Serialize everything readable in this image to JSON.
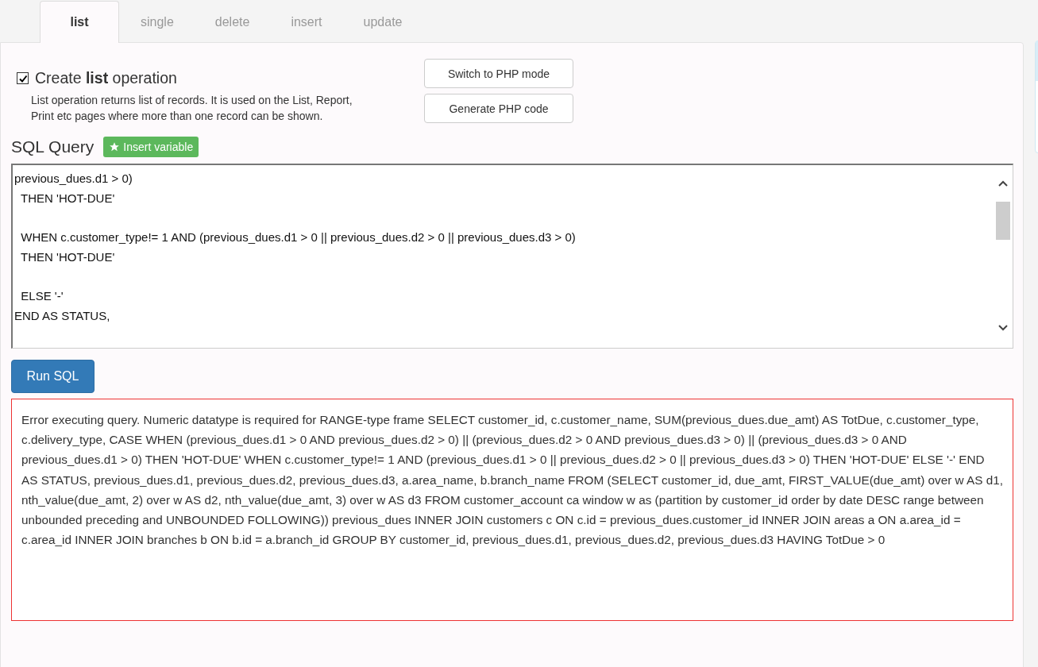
{
  "tabs": [
    {
      "label": "list",
      "selected": true
    },
    {
      "label": "single",
      "selected": false
    },
    {
      "label": "delete",
      "selected": false
    },
    {
      "label": "insert",
      "selected": false
    },
    {
      "label": "update",
      "selected": false
    }
  ],
  "operation": {
    "checked": true,
    "label": "Create **list** operation",
    "description": "List operation returns list of records. It is used on the List, Report, Print etc pages where more than one record can be shown."
  },
  "buttons": [
    "Switch to PHP mode",
    "Generate PHP code"
  ],
  "sql_query": {
    "title": "SQL Query",
    "insert_button": "Insert variable",
    "blocks": [
      [
        "previous_dues.d1 > 0)",
        "  THEN 'HOT-DUE'"
      ],
      [
        "  WHEN c.customer_type!= 1 AND (previous_dues.d1 > 0 || previous_dues.d2 > 0 || previous_dues.d3 > 0)",
        "  THEN 'HOT-DUE'"
      ],
      [
        "  ELSE '-'",
        "END AS STATUS,"
      ]
    ]
  },
  "run_button": "Run SQL",
  "error_message": "Error executing query. Numeric datatype is required for RANGE-type frame SELECT customer_id, c.customer_name, SUM(previous_dues.due_amt) AS TotDue, c.customer_type, c.delivery_type, CASE WHEN (previous_dues.d1 > 0 AND previous_dues.d2 > 0) || (previous_dues.d2 > 0 AND previous_dues.d3 > 0) || (previous_dues.d3 > 0 AND previous_dues.d1 > 0) THEN 'HOT-DUE' WHEN c.customer_type!= 1 AND (previous_dues.d1 > 0 || previous_dues.d2 > 0 || previous_dues.d3 > 0) THEN 'HOT-DUE' ELSE '-' END AS STATUS, previous_dues.d1, previous_dues.d2, previous_dues.d3, a.area_name, b.branch_name FROM (SELECT customer_id, due_amt, FIRST_VALUE(due_amt) over w AS d1, nth_value(due_amt, 2) over w AS d2, nth_value(due_amt, 3) over w AS d3 FROM customer_account ca window w as (partition by customer_id order by date DESC range between unbounded preceding and UNBOUNDED FOLLOWING)) previous_dues INNER JOIN customers c ON c.id = previous_dues.customer_id INNER JOIN areas a ON a.area_id = c.area_id INNER JOIN branches b ON b.id = a.branch_id GROUP BY customer_id, previous_dues.d1, previous_dues.d2, previous_dues.d3 HAVING TotDue > 0"
}
